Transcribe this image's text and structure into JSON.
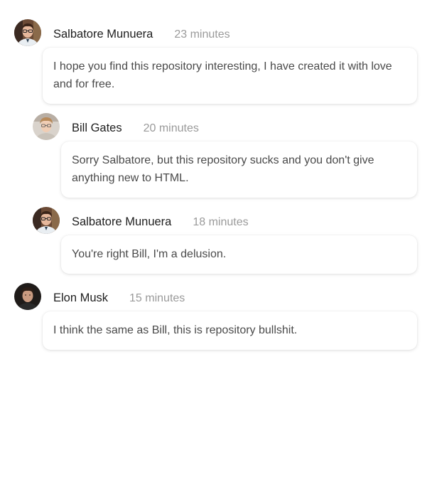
{
  "comments": [
    {
      "author": "Salbatore Munuera",
      "time": "23 minutes",
      "text": "I hope you find this repository interesting, I have created it with love and for free."
    },
    {
      "author": "Bill Gates",
      "time": "20 minutes",
      "text": "Sorry Salbatore, but this repository sucks and you don't give anything new to HTML."
    },
    {
      "author": "Salbatore Munuera",
      "time": "18 minutes",
      "text": "You're right Bill, I'm a delusion."
    },
    {
      "author": "Elon Musk",
      "time": "15 minutes",
      "text": "I think the same as Bill, this is repository bullshit."
    }
  ]
}
